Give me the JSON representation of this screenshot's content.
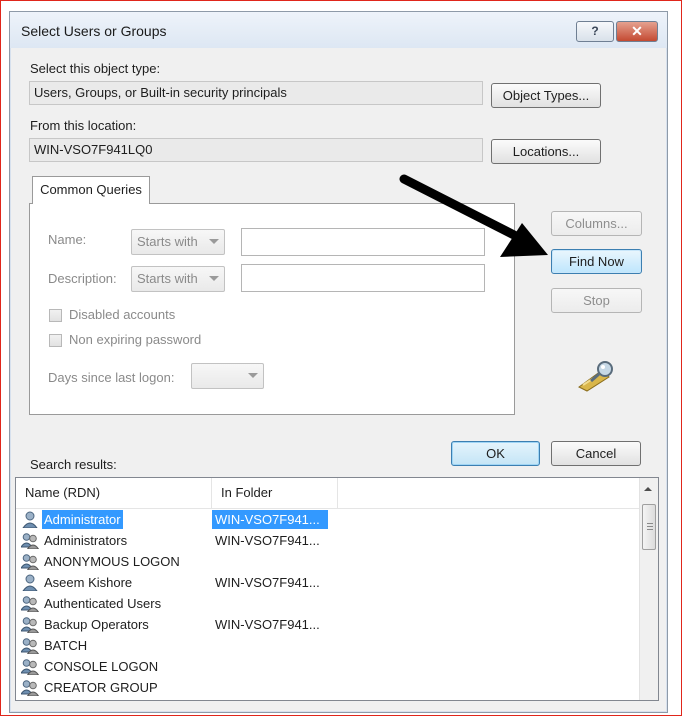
{
  "dialog": {
    "title": "Select Users or Groups",
    "help_label": "?",
    "close_label": "✕"
  },
  "object_type": {
    "label": "Select this object type:",
    "value": "Users, Groups, or Built-in security principals",
    "button": "Object Types..."
  },
  "location": {
    "label": "From this location:",
    "value": "WIN-VSO7F941LQ0",
    "button": "Locations..."
  },
  "common_queries": {
    "tab": "Common Queries",
    "name_label": "Name:",
    "name_mode": "Starts with",
    "description_label": "Description:",
    "description_mode": "Starts with",
    "disabled_accounts": "Disabled accounts",
    "non_expiring": "Non expiring password",
    "days_label": "Days since last logon:"
  },
  "side_buttons": {
    "columns": "Columns...",
    "find_now": "Find Now",
    "stop": "Stop"
  },
  "actions": {
    "ok": "OK",
    "cancel": "Cancel"
  },
  "results": {
    "label": "Search results:",
    "columns": [
      "Name (RDN)",
      "In Folder"
    ],
    "rows": [
      {
        "name": "Administrator",
        "folder": "WIN-VSO7F941...",
        "icon": "user-icon",
        "selected": true
      },
      {
        "name": "Administrators",
        "folder": "WIN-VSO7F941...",
        "icon": "group-icon"
      },
      {
        "name": "ANONYMOUS LOGON",
        "folder": "",
        "icon": "group-icon"
      },
      {
        "name": "Aseem Kishore",
        "folder": "WIN-VSO7F941...",
        "icon": "user-icon"
      },
      {
        "name": "Authenticated Users",
        "folder": "",
        "icon": "group-icon"
      },
      {
        "name": "Backup Operators",
        "folder": "WIN-VSO7F941...",
        "icon": "group-icon"
      },
      {
        "name": "BATCH",
        "folder": "",
        "icon": "group-icon"
      },
      {
        "name": "CONSOLE LOGON",
        "folder": "",
        "icon": "group-icon"
      },
      {
        "name": "CREATOR GROUP",
        "folder": "",
        "icon": "group-icon"
      }
    ]
  },
  "colors": {
    "selection": "#3399ff",
    "annotation_arrow": "#000000",
    "frame_border": "#e0261b"
  }
}
